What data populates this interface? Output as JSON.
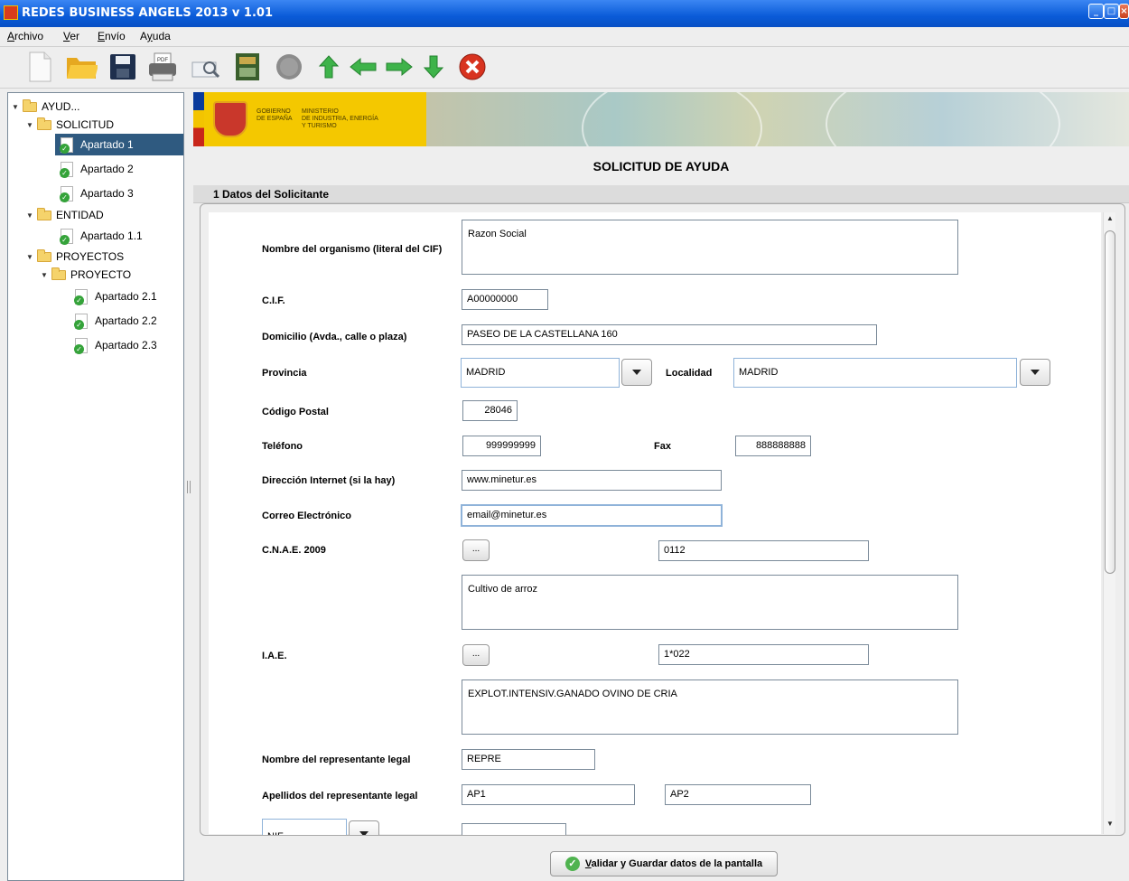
{
  "window": {
    "title": "REDES BUSINESS ANGELS 2013  v 1.01"
  },
  "menu": [
    {
      "pre": "",
      "u": "A",
      "post": "rchivo"
    },
    {
      "pre": "",
      "u": "V",
      "post": "er"
    },
    {
      "pre": "",
      "u": "E",
      "post": "nvío"
    },
    {
      "pre": "A",
      "u": "y",
      "post": "uda"
    }
  ],
  "toolbar": {
    "icons": [
      "new-document-icon",
      "open-folder-icon",
      "save-disk-icon",
      "print-pdf-icon",
      "preview-magnifier-icon",
      "book-icon",
      "stamp-icon",
      "up-arrow-icon",
      "left-arrow-icon",
      "right-arrow-icon",
      "down-arrow-icon",
      "close-circle-icon"
    ]
  },
  "tree": {
    "items": [
      {
        "label": "AYUD...",
        "type": "folder",
        "expanded": true
      },
      {
        "label": "SOLICITUD",
        "type": "folder",
        "expanded": true
      },
      {
        "label": "Apartado 1",
        "type": "doc",
        "selected": true
      },
      {
        "label": "Apartado 2",
        "type": "doc"
      },
      {
        "label": "Apartado 3",
        "type": "doc"
      },
      {
        "label": "ENTIDAD",
        "type": "folder",
        "expanded": true
      },
      {
        "label": "Apartado 1.1",
        "type": "doc"
      },
      {
        "label": "PROYECTOS",
        "type": "folder",
        "expanded": true
      },
      {
        "label": "PROYECTO",
        "type": "folder",
        "expanded": true
      },
      {
        "label": "Apartado 2.1",
        "type": "doc"
      },
      {
        "label": "Apartado 2.2",
        "type": "doc"
      },
      {
        "label": "Apartado 2.3",
        "type": "doc"
      }
    ]
  },
  "banner": {
    "gov_line1": "GOBIERNO",
    "gov_line2": "DE ESPAÑA",
    "min_line1": "MINISTERIO",
    "min_line2": "DE INDUSTRIA, ENERGÍA",
    "min_line3": "Y TURISMO"
  },
  "form": {
    "title": "SOLICITUD DE AYUDA",
    "section": "1 Datos del Solicitante",
    "labels": {
      "nombre": "Nombre del organismo (literal del CIF)",
      "cif": "C.I.F.",
      "domicilio": "Domicilio (Avda., calle o plaza)",
      "provincia": "Provincia",
      "localidad": "Localidad",
      "cp": "Código Postal",
      "telefono": "Teléfono",
      "fax": "Fax",
      "web": "Dirección Internet (si la hay)",
      "email": "Correo Electrónico",
      "cnae": "C.N.A.E. 2009",
      "iae": "I.A.E.",
      "rep_nombre": "Nombre del representante legal",
      "rep_apellidos": "Apellidos del representante legal"
    },
    "values": {
      "nombre": "Razon Social",
      "cif": "A00000000",
      "domicilio": "PASEO DE LA CASTELLANA 160",
      "provincia": "MADRID",
      "localidad": "MADRID",
      "cp": "28046",
      "telefono": "999999999",
      "fax": "888888888",
      "web": "www.minetur.es",
      "email": "email@minetur.es",
      "cnae_code": "0112",
      "cnae_desc": "Cultivo de arroz",
      "iae_code": "1*022",
      "iae_desc": "EXPLOT.INTENSIV.GANADO OVINO DE CRIA",
      "rep_nombre": "REPRE",
      "rep_ap1": "AP1",
      "rep_ap2": "AP2",
      "doc_type": "NIF",
      "doc_number": ""
    },
    "browse_label": "..."
  },
  "save_button": {
    "u": "V",
    "rest": "alidar y Guardar datos de la pantalla"
  }
}
